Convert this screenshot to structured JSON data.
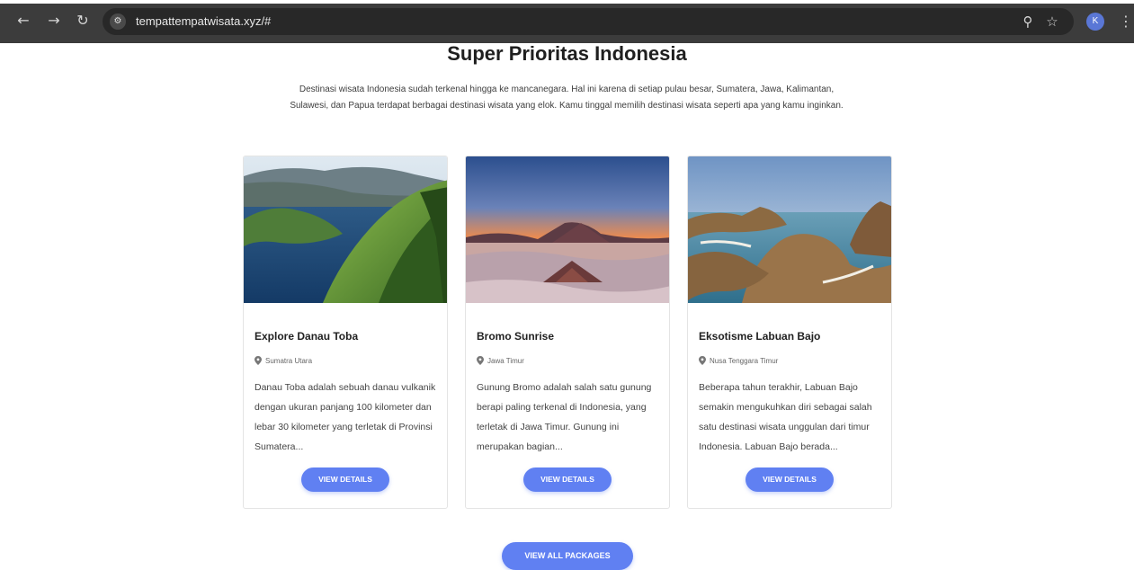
{
  "browser": {
    "url": "tempattempatwisata.xyz/#",
    "profile_initial": "K",
    "icons": [
      "back-arrow-icon",
      "forward-arrow-icon",
      "reload-icon",
      "site-info-icon",
      "zoom-icon",
      "bookmark-star-icon",
      "menu-kebab-icon"
    ]
  },
  "section": {
    "title": "Super Prioritas Indonesia",
    "intro": "Destinasi wisata Indonesia sudah terkenal hingga ke mancanegara. Hal ini karena di setiap pulau besar, Sumatera, Jawa, Kalimantan, Sulawesi, dan Papua terdapat berbagai destinasi wisata yang elok. Kamu tinggal memilih destinasi wisata seperti apa yang kamu inginkan."
  },
  "cards": [
    {
      "title": "Explore Danau Toba",
      "location": "Sumatra Utara",
      "description": "Danau Toba adalah sebuah danau vulkanik dengan ukuran panjang 100 kilometer dan lebar 30 kilometer yang terletak di Provinsi Sumatera...",
      "button": "VIEW DETAILS"
    },
    {
      "title": "Bromo Sunrise",
      "location": "Jawa Timur",
      "description": "Gunung Bromo adalah salah satu gunung berapi paling terkenal di Indonesia, yang terletak di Jawa Timur. Gunung ini merupakan bagian...",
      "button": "VIEW DETAILS"
    },
    {
      "title": "Eksotisme Labuan Bajo",
      "location": "Nusa Tenggara Timur",
      "description": "Beberapa tahun terakhir, Labuan Bajo semakin mengukuhkan diri sebagai salah satu destinasi wisata unggulan dari timur Indonesia. Labuan Bajo berada...",
      "button": "VIEW DETAILS"
    }
  ],
  "footer": {
    "all_button": "VIEW ALL PACKAGES"
  },
  "colors": {
    "accent": "#6080f2",
    "chrome_bg": "#3c3c3c",
    "omnibox_bg": "#282828",
    "profile": "#5a77d6"
  }
}
